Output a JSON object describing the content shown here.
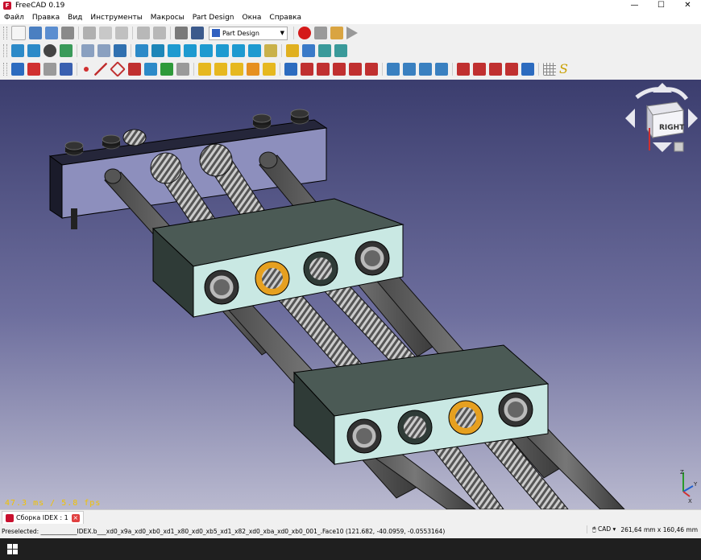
{
  "window": {
    "title": "FreeCAD 0.19",
    "app_icon_letter": "F",
    "minimize": "—",
    "maximize": "☐",
    "close": "✕"
  },
  "menu": [
    "Файл",
    "Правка",
    "Вид",
    "Инструменты",
    "Макросы",
    "Part Design",
    "Окна",
    "Справка"
  ],
  "toolbar": {
    "workbench": "Part Design"
  },
  "viewport": {
    "fps": "47.3 ms / 5.8 fps",
    "navcube_face": "RIGHT",
    "axis_labels": {
      "x": "X",
      "y": "Y",
      "z": "Z"
    }
  },
  "tab": {
    "label": "Сборка IDEX : 1",
    "close": "×"
  },
  "status": {
    "preselected": "Preselected: ____________IDEX.b___xd0_x9a_xd0_xb0_xd1_x80_xd0_xb5_xd1_x82_xd0_xba_xd0_xb0_001_.Face10 (121.682, -40.0959, -0.0553164)",
    "nav_style": "CAD",
    "dimensions": "261,64 mm x 160,46 mm"
  },
  "colors": {
    "block": "#3d4a45",
    "face": "#c9e8e3",
    "rod": "#5a5a5a",
    "bushing": "#e6a020",
    "plate": "#8d8fbd"
  }
}
